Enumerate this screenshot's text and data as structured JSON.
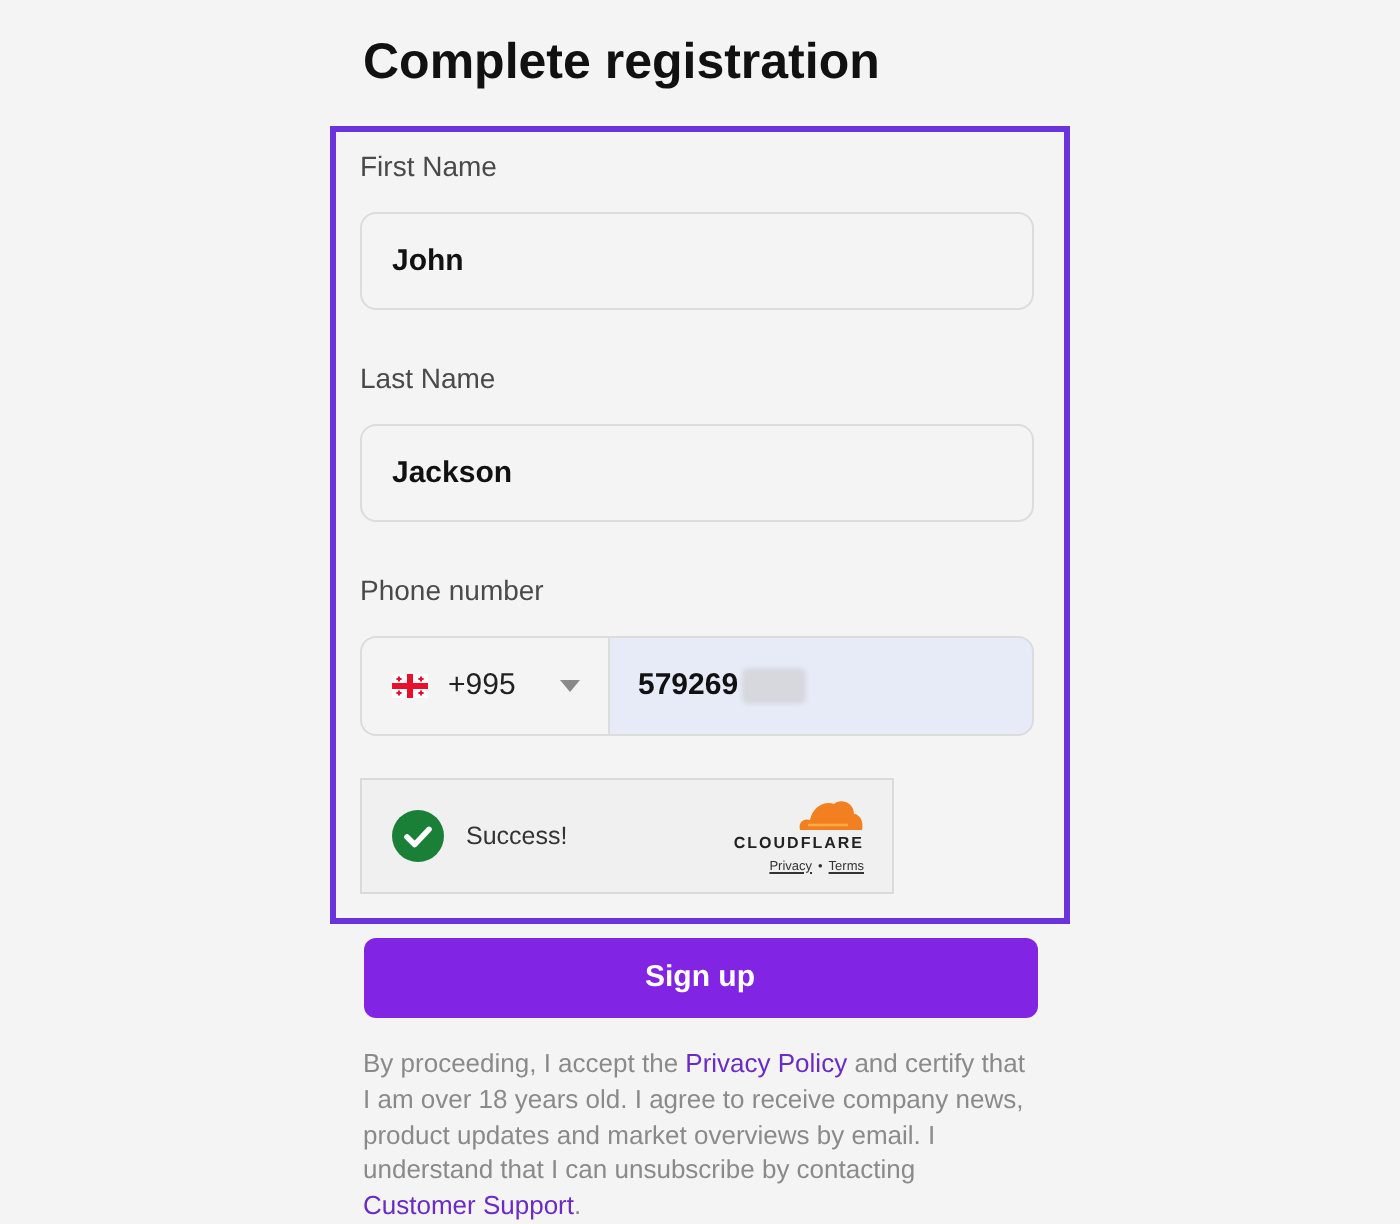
{
  "page": {
    "title": "Complete registration"
  },
  "form": {
    "highlighted": true,
    "fields": [
      {
        "kind": "text",
        "label": "First Name",
        "value": "John"
      },
      {
        "kind": "text",
        "label": "Last Name",
        "value": "Jackson"
      },
      {
        "kind": "phone",
        "label": "Phone number",
        "country_code": "+995",
        "value": "579269",
        "autofilled": true,
        "redacted": true
      }
    ],
    "captcha": {
      "status": "Success!",
      "verified": true,
      "brand": "CLOUDFLARE",
      "links": [
        "Privacy",
        "Terms"
      ],
      "separator": "•"
    }
  },
  "submit_button": "Sign up",
  "consent": [
    {
      "kind": "text",
      "text": "By proceeding, I accept the "
    },
    {
      "kind": "link",
      "text": "Privacy Policy"
    },
    {
      "kind": "text",
      "text": " and certify that I am over 18 years old. I agree to receive company news, product updates and market overviews by email. I understand that I can unsubscribe by contacting "
    },
    {
      "kind": "link",
      "text": "Customer Support"
    },
    {
      "kind": "text",
      "text": "."
    }
  ]
}
